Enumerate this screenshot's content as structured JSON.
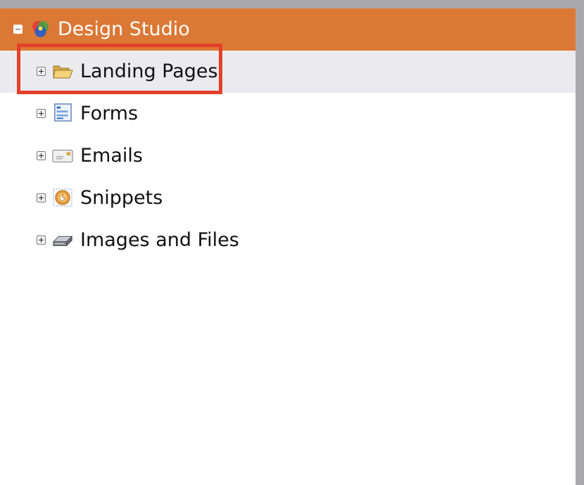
{
  "tree": {
    "root": {
      "label": "Design Studio",
      "icon": "design-studio-icon",
      "expanded": true
    },
    "items": [
      {
        "label": "Landing Pages",
        "icon": "folder-icon",
        "selected": true
      },
      {
        "label": "Forms",
        "icon": "form-icon"
      },
      {
        "label": "Emails",
        "icon": "email-icon"
      },
      {
        "label": "Snippets",
        "icon": "snippet-icon"
      },
      {
        "label": "Images and Files",
        "icon": "image-files-icon"
      }
    ]
  },
  "colors": {
    "root_background": "#dc7835",
    "selected_background": "#ebebef",
    "highlight_border": "#e2402b"
  }
}
